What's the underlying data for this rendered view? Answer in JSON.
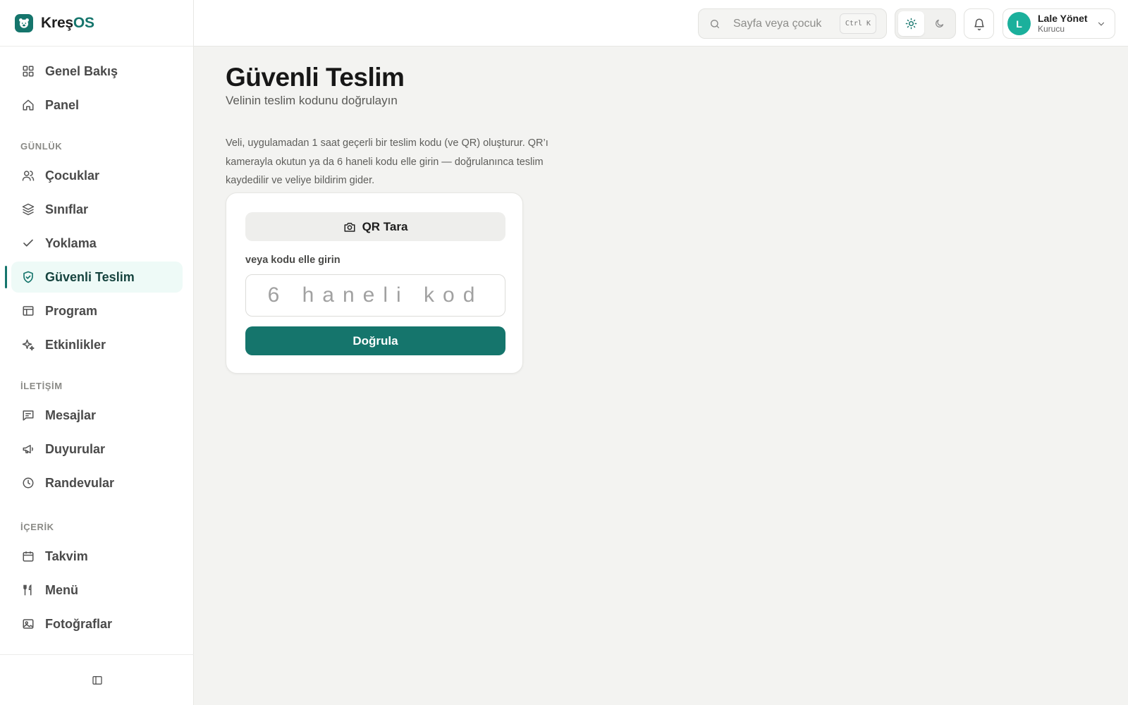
{
  "brand": {
    "name_main": "Kreş",
    "name_accent": "OS",
    "accent_color": "#15756c"
  },
  "sidebar": {
    "items_top": [
      {
        "label": "Genel Bakış",
        "icon": "grid-icon"
      },
      {
        "label": "Panel",
        "icon": "home-icon"
      }
    ],
    "sections": [
      {
        "title": "GÜNLÜK",
        "items": [
          {
            "label": "Çocuklar",
            "icon": "users-icon"
          },
          {
            "label": "Sınıflar",
            "icon": "layers-icon"
          },
          {
            "label": "Yoklama",
            "icon": "check-icon"
          },
          {
            "label": "Güvenli Teslim",
            "icon": "shield-check-icon",
            "active": true
          },
          {
            "label": "Program",
            "icon": "table-icon"
          },
          {
            "label": "Etkinlikler",
            "icon": "sparkles-icon"
          }
        ]
      },
      {
        "title": "İLETİŞİM",
        "items": [
          {
            "label": "Mesajlar",
            "icon": "message-icon"
          },
          {
            "label": "Duyurular",
            "icon": "megaphone-icon"
          },
          {
            "label": "Randevular",
            "icon": "clock-icon"
          }
        ]
      },
      {
        "title": "İÇERİK",
        "items": [
          {
            "label": "Takvim",
            "icon": "calendar-icon"
          },
          {
            "label": "Menü",
            "icon": "utensils-icon"
          },
          {
            "label": "Fotoğraflar",
            "icon": "image-icon"
          }
        ]
      }
    ]
  },
  "topbar": {
    "search_placeholder": "Sayfa veya çocuk",
    "search_shortcut": "Ctrl K",
    "theme": "light",
    "user": {
      "initial": "L",
      "name": "Lale Yönet",
      "role": "Kurucu",
      "avatar_color": "#1bb09c"
    }
  },
  "page": {
    "title": "Güvenli Teslim",
    "subtitle": "Velinin teslim kodunu doğrulayın",
    "description": "Veli, uygulamadan 1 saat geçerli bir teslim kodu (ve QR) oluşturur. QR’ı kamerayla okutun ya da 6 haneli kodu elle girin — doğrulanınca teslim kaydedilir ve veliye bildirim gider.",
    "qr_button": "QR Tara",
    "manual_label": "veya kodu elle girin",
    "code_value": "",
    "code_placeholder": "6 haneli kod",
    "verify_button": "Doğrula"
  }
}
